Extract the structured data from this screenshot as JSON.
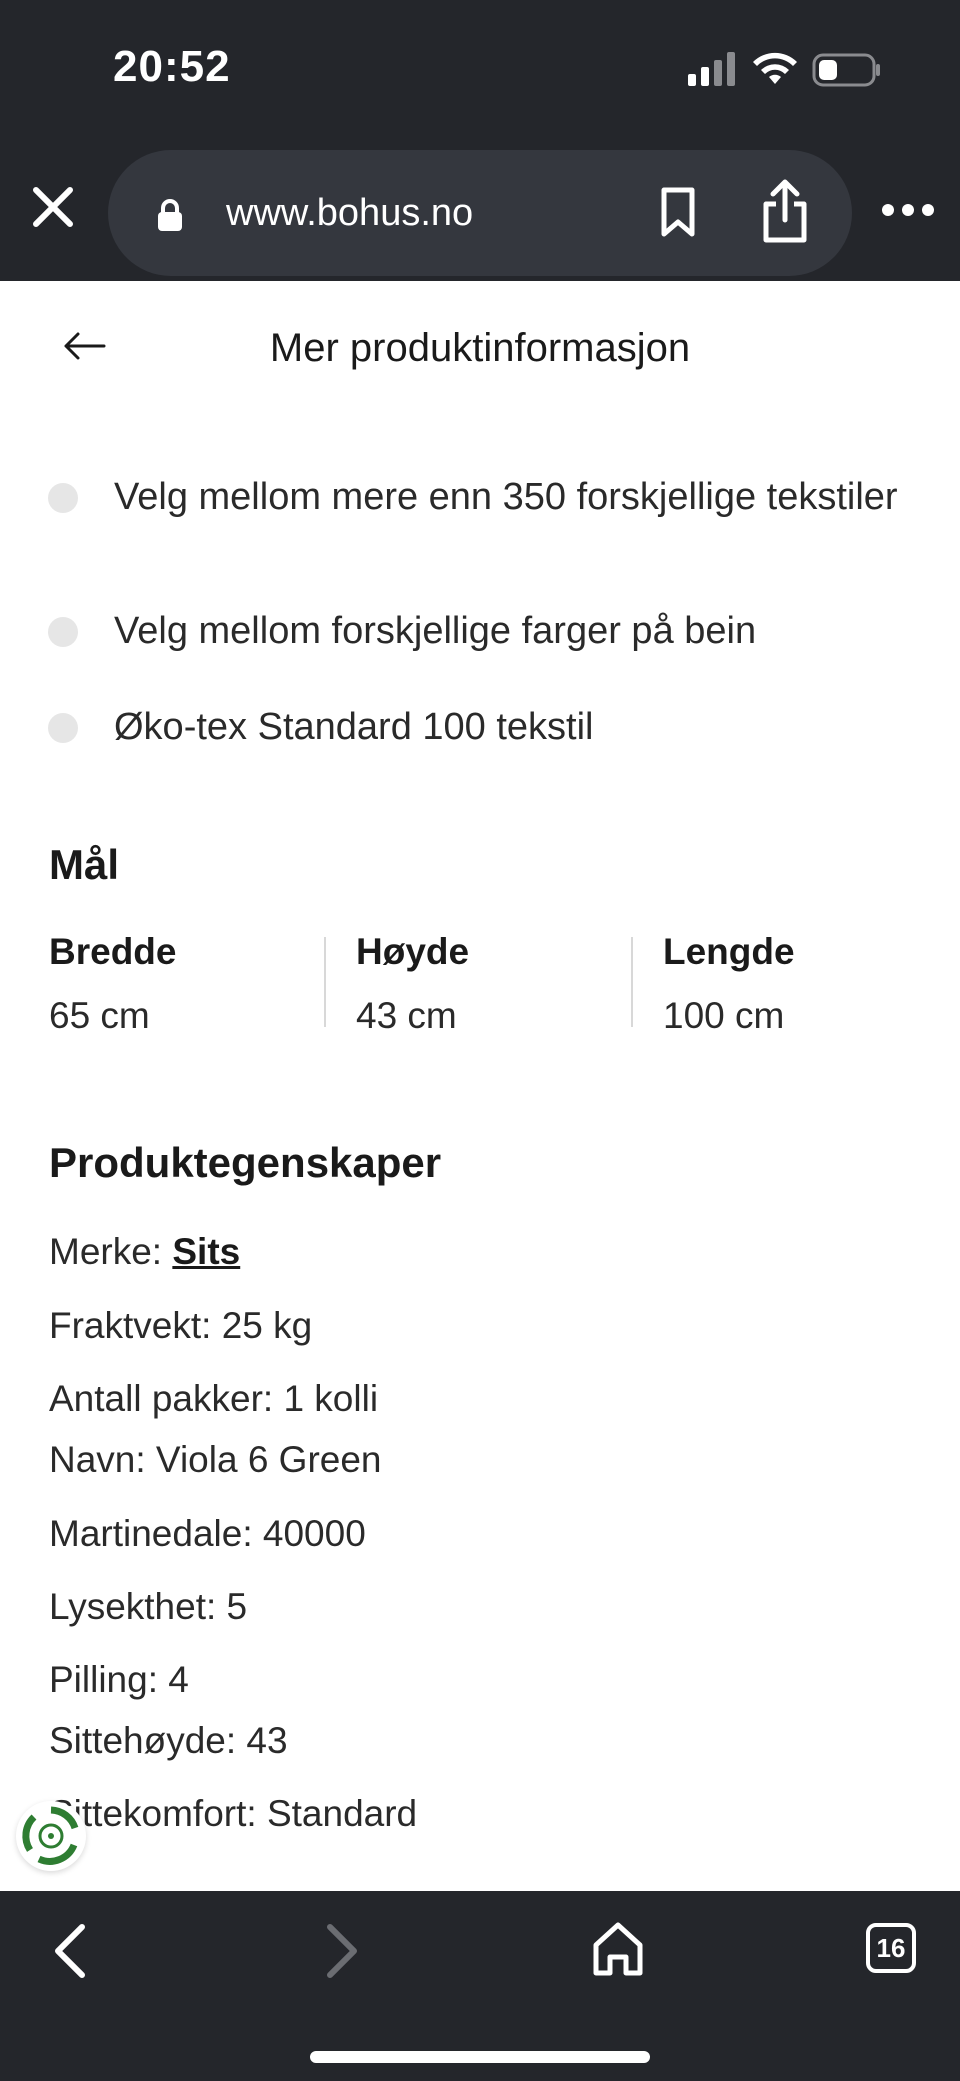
{
  "status_bar": {
    "time": "20:52"
  },
  "browser": {
    "url": "www.bohus.no",
    "tab_count": "16"
  },
  "page": {
    "title": "Mer produktinformasjon",
    "features": [
      "Velg mellom mere enn 350 forskjellige tekstiler",
      "Velg mellom forskjellige farger på bein",
      "Øko-tex Standard 100 tekstil"
    ],
    "dimensions": {
      "title": "Mål",
      "items": [
        {
          "label": "Bredde",
          "value": "65 cm"
        },
        {
          "label": "Høyde",
          "value": "43 cm"
        },
        {
          "label": "Lengde",
          "value": "100 cm"
        }
      ]
    },
    "properties": {
      "title": "Produktegenskaper",
      "brand_label": "Merke: ",
      "brand_value": "Sits",
      "items": [
        "Fraktvekt: 25 kg",
        "Antall pakker: 1 kolli",
        "Navn: Viola 6 Green",
        "Martinedale: 40000",
        "Lysekthet: 5",
        "Pilling: 4",
        "Sittehøyde: 43",
        "Sittekomfort: Standard"
      ]
    }
  },
  "icons": {
    "close": "close-icon",
    "lock": "lock-icon",
    "bookmark": "bookmark-icon",
    "share": "share-icon",
    "more": "more-icon",
    "back": "arrow-left-icon",
    "recycle": "recycle-icon"
  },
  "colors": {
    "chrome": "#24262b",
    "url_pill": "#34373e",
    "bullet": "#e6e6e6",
    "badge_green": "#2e7d32"
  }
}
